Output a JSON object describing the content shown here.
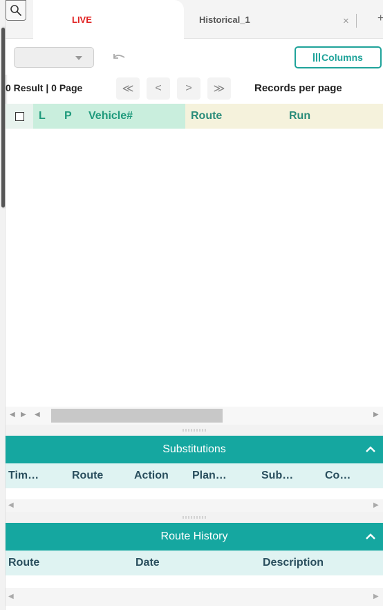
{
  "tabs": {
    "live_label": "LIVE",
    "historical_label": "Historical_1",
    "close_glyph": "×",
    "add_glyph": "+"
  },
  "toolbar": {
    "select_value": "",
    "columns_label": "Columns"
  },
  "pager": {
    "count_text": "0 Result | 0 Page",
    "first": "≪",
    "prev": "<",
    "next": ">",
    "last": "≫",
    "records_per_page_label": "Records per page"
  },
  "grid": {
    "columns": [
      "L",
      "P",
      "Vehicle#",
      "Route",
      "Run"
    ],
    "rows": []
  },
  "substitutions": {
    "title": "Substitutions",
    "columns": [
      "Tim…",
      "Route",
      "Action",
      "Plan…",
      "Sub…",
      "Co…"
    ]
  },
  "route_history": {
    "title": "Route History",
    "columns": [
      "Route",
      "Date",
      "Description"
    ]
  },
  "colors": {
    "accent": "#15a7a0",
    "live_tab": "#e02020",
    "header_green": "#c9eedd",
    "header_tan": "#f5f2dc"
  },
  "icons": {
    "search": "search-icon",
    "undo": "undo-icon",
    "collapse": "chevron-up-icon"
  }
}
